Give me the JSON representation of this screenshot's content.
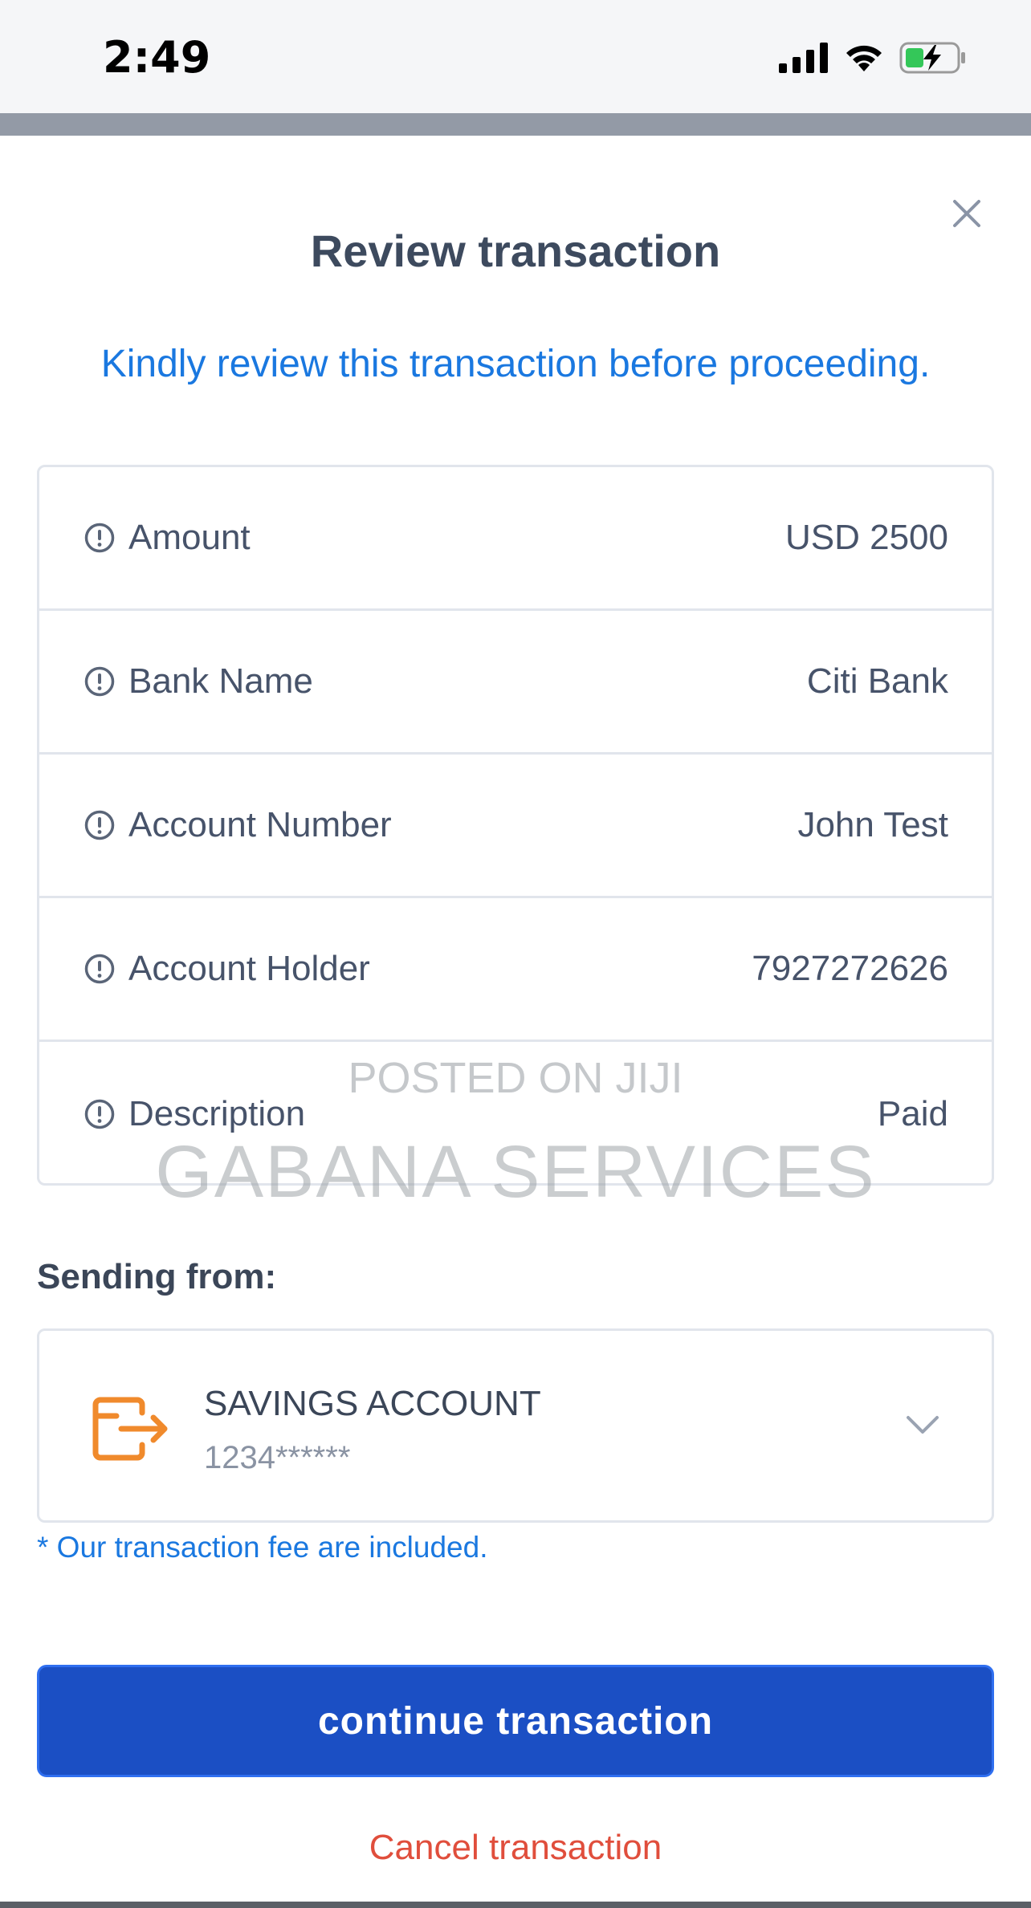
{
  "status_bar": {
    "time": "2:49"
  },
  "modal": {
    "title": "Review transaction",
    "subtitle": "Kindly review this transaction before proceeding."
  },
  "details": [
    {
      "label": "Amount",
      "value": "USD 2500"
    },
    {
      "label": "Bank Name",
      "value": "Citi Bank"
    },
    {
      "label": "Account Number",
      "value": "John Test"
    },
    {
      "label": "Account Holder",
      "value": "7927272626"
    },
    {
      "label": "Description",
      "value": "Paid"
    }
  ],
  "watermark": {
    "line1": "POSTED ON JIJI",
    "line2": "GABANA SERVICES"
  },
  "sending_from": {
    "label": "Sending from:",
    "account_name": "SAVINGS ACCOUNT",
    "account_number": "1234******"
  },
  "fee_note": "* Our transaction fee are included.",
  "actions": {
    "continue_label": "continue transaction",
    "cancel_label": "Cancel transaction"
  },
  "colors": {
    "primary": "#1b4fc4",
    "link": "#1a78e0",
    "danger": "#e04e3c",
    "account_icon": "#f08a2c"
  },
  "icons": {
    "close": "close-icon",
    "info": "info-circle-icon",
    "account": "wallet-transfer-icon",
    "chevron": "chevron-down-icon"
  }
}
